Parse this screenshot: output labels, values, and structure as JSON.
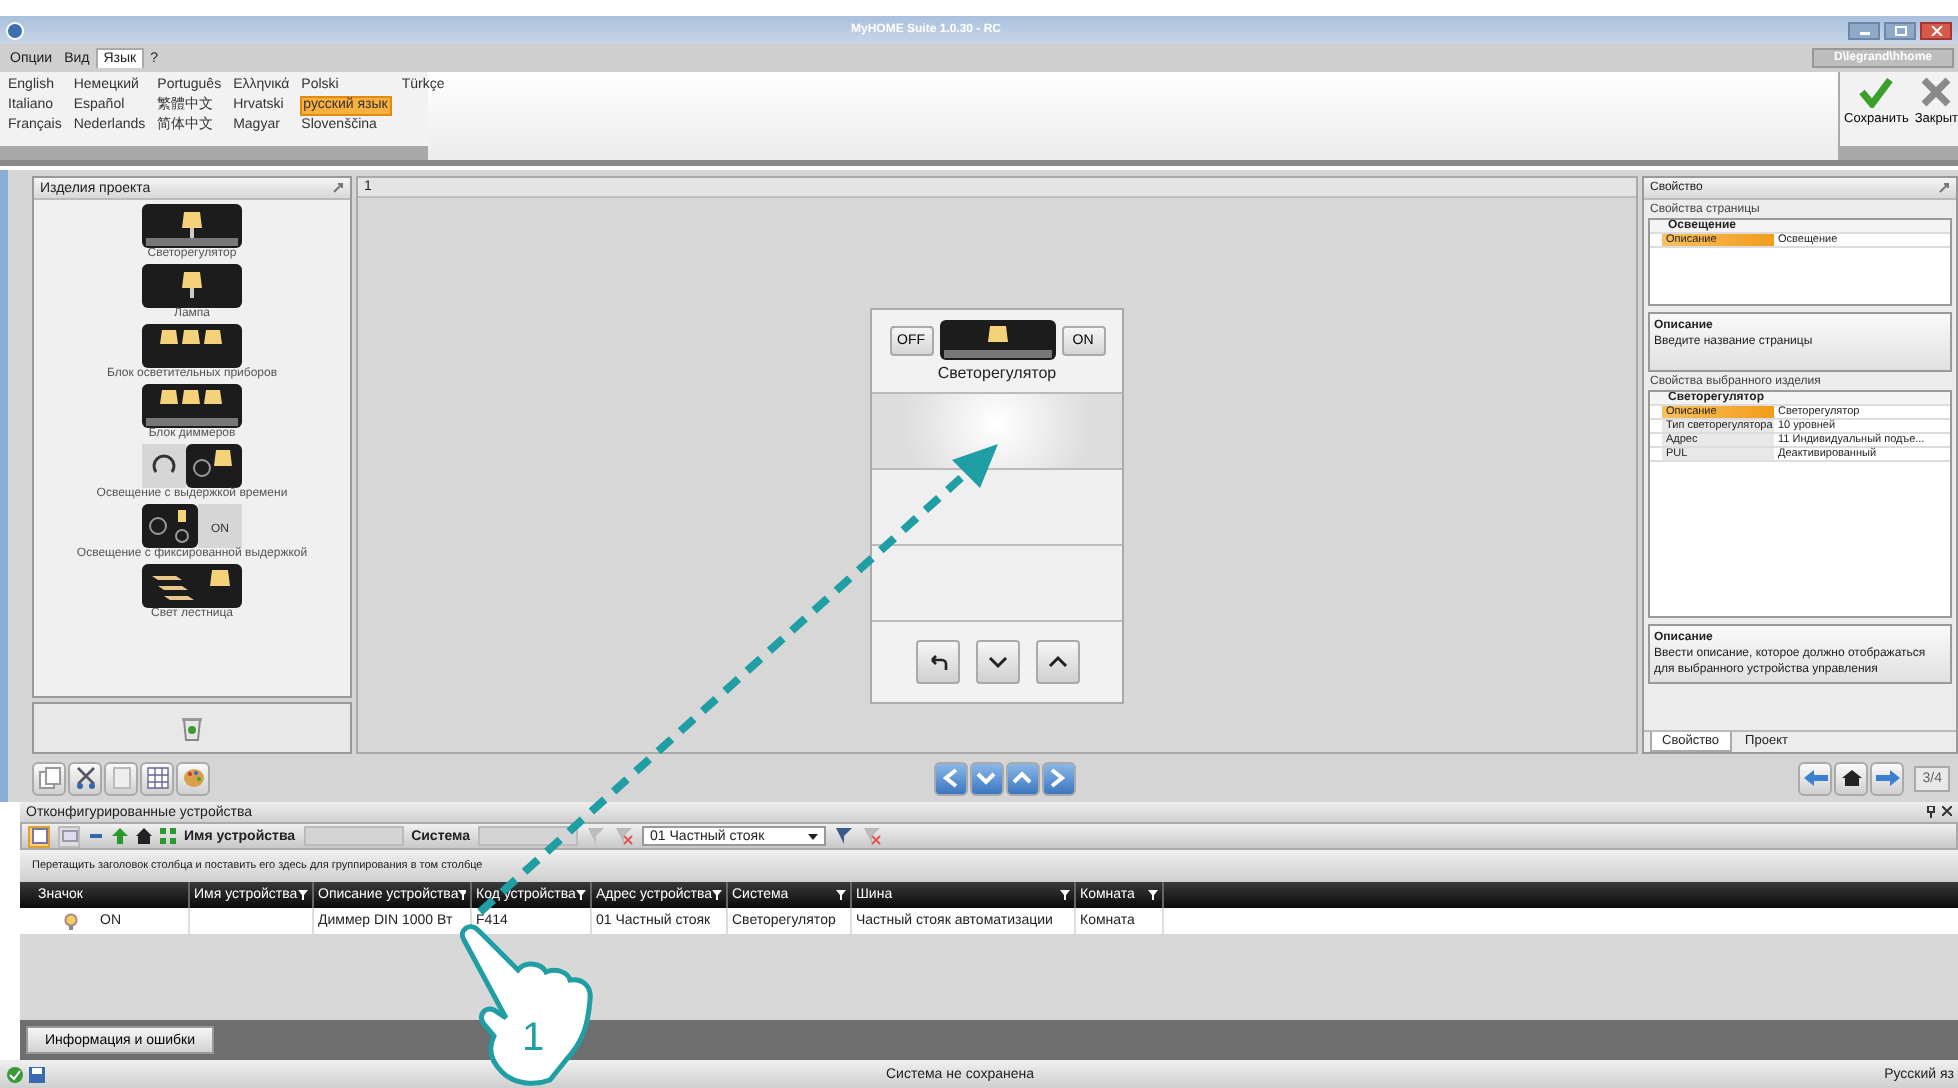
{
  "window": {
    "title": "MyHOME Suite 1.0.30 - RC",
    "user": "D\\legrand\\hhome"
  },
  "menu": [
    {
      "label": "Опции",
      "selected": false
    },
    {
      "label": "Вид",
      "selected": false
    },
    {
      "label": "Язык",
      "selected": true
    },
    {
      "label": "?",
      "selected": false
    }
  ],
  "languages": [
    {
      "label": "English",
      "selected": false
    },
    {
      "label": "Italiano",
      "selected": false
    },
    {
      "label": "Français",
      "selected": false
    },
    {
      "label": "Немецкий",
      "selected": false
    },
    {
      "label": "Español",
      "selected": false
    },
    {
      "label": "Nederlands",
      "selected": false
    },
    {
      "label": "Português",
      "selected": false
    },
    {
      "label": "繁體中文",
      "selected": false
    },
    {
      "label": "简体中文",
      "selected": false
    },
    {
      "label": "Ελληνικά",
      "selected": false
    },
    {
      "label": "Hrvatski",
      "selected": false
    },
    {
      "label": "Magyar",
      "selected": false
    },
    {
      "label": "Polski",
      "selected": false
    },
    {
      "label": "русский язык",
      "selected": true
    },
    {
      "label": "Slovenščina",
      "selected": false
    },
    {
      "label": "Türkçe",
      "selected": false
    }
  ],
  "ribbon": [
    {
      "kind": "save",
      "label": "Сохранить"
    },
    {
      "kind": "close",
      "label": "Закрыт"
    }
  ],
  "products": {
    "title": "Изделия проекта",
    "items": [
      {
        "kind": "dimmer",
        "label": "Светорегулятор"
      },
      {
        "kind": "lamp",
        "label": "Лампа"
      },
      {
        "kind": "lamp-group",
        "label": "Блок осветительных приборов"
      },
      {
        "kind": "dimmer-group",
        "label": "Блок диммеров"
      },
      {
        "kind": "timed",
        "label": "Освещение с выдержкой времени"
      },
      {
        "kind": "fixed-timed",
        "label": "Освещение с фиксированной выдержкой",
        "icon_text": "ON"
      },
      {
        "kind": "stairs",
        "label": "Свет лестница"
      }
    ]
  },
  "canvas": {
    "tab": "1",
    "widget": {
      "off": "OFF",
      "on": "ON",
      "label": "Светорегулятор"
    },
    "page": "3/4"
  },
  "properties": {
    "title": "Свойство",
    "page_section": "Свойства страницы",
    "page_group": "Освещение",
    "page_rows": [
      {
        "name": "Описание",
        "value": "Освещение",
        "selected": true
      }
    ],
    "page_help": {
      "title": "Описание",
      "text": "Введите название страницы"
    },
    "item_section": "Свойства выбранного изделия",
    "item_group": "Светорегулятор",
    "item_rows": [
      {
        "name": "Описание",
        "value": "Светорегулятор",
        "selected": true
      },
      {
        "name": "Тип светорегулятора",
        "value": "10 уровней",
        "selected": false
      },
      {
        "name": "Адрес",
        "value": "11 Индивидуальный подъе...",
        "selected": false
      },
      {
        "name": "PUL",
        "value": "Деактивированный",
        "selected": false
      }
    ],
    "item_help": {
      "title": "Описание",
      "text": "Ввести описание, которое должно отображаться для выбранного устройства управления"
    },
    "tabs": [
      {
        "label": "Свойство",
        "selected": true
      },
      {
        "label": "Проект",
        "selected": false
      }
    ]
  },
  "devices": {
    "title": "Отконфигурированные устройства",
    "name_label": "Имя устройства",
    "system_label": "Система",
    "riser": "01 Частный стояк",
    "group_hint": "Перетащить заголовок столбца и поставить его здесь для группирования в том столбце",
    "columns": [
      "Значок",
      "Имя устройства",
      "Описание устройства",
      "Код устройства",
      "Адрес устройства",
      "Система",
      "Шина",
      "Комната"
    ],
    "rows": [
      {
        "cells": [
          "ON",
          "",
          "Диммер DIN 1000 Вт",
          "F414",
          "01 Частный стояк",
          "Светорегулятор",
          "Частный стояк автоматизации",
          "Комната"
        ]
      }
    ],
    "info_button": "Информация и ошибки"
  },
  "status_bar": {
    "message": "Система не сохранена",
    "language": "Русский яз"
  },
  "annotation": {
    "step": "1"
  }
}
